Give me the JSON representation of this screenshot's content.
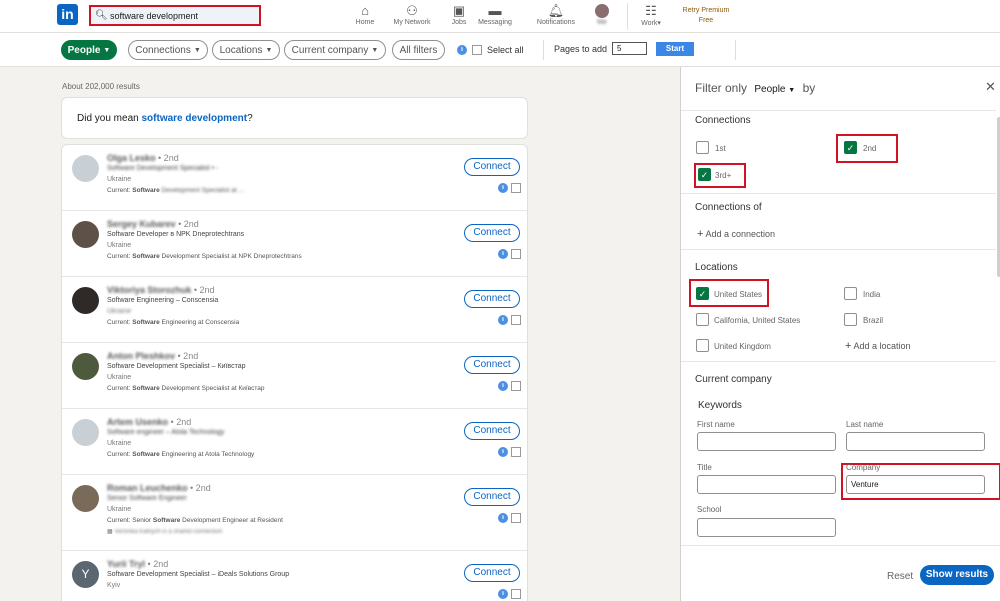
{
  "nav": {
    "logo": "in",
    "search_value": "software development",
    "items": [
      {
        "label": "Home",
        "icon": "home-icon"
      },
      {
        "label": "My Network",
        "icon": "network-icon"
      },
      {
        "label": "Jobs",
        "icon": "briefcase-icon"
      },
      {
        "label": "Messaging",
        "icon": "messaging-icon"
      },
      {
        "label": "Notifications",
        "icon": "bell-icon"
      },
      {
        "label": "Me",
        "icon": "avatar"
      },
      {
        "label": "Work",
        "icon": "grid-icon"
      }
    ],
    "premium_line1": "Retry Premium",
    "premium_line2": "Free"
  },
  "filters": {
    "people": "People",
    "connections": "Connections",
    "locations": "Locations",
    "current_company": "Current company",
    "all_filters": "All filters",
    "select_all": "Select all",
    "pages_to_add_label": "Pages to add",
    "pages_to_add_value": "5",
    "start": "Start"
  },
  "results": {
    "count": "About 202,000 results",
    "did_you_mean_prefix": "Did you mean ",
    "did_you_mean_link": "software development",
    "did_you_mean_suffix": "?",
    "connect_label": "Connect",
    "people": [
      {
        "name": "Olga Lesko",
        "degree": "• 2nd",
        "headline": "Software Development Specialist • -",
        "location": "Ukraine",
        "current_prefix": "Current: ",
        "current_bold": "Software",
        "current_rest": " Development Specialist at ...",
        "extra": ""
      },
      {
        "name": "Sergey Kubarev",
        "degree": "• 2nd",
        "headline": "Software Developer в NPK Dneprotechtrans",
        "location": "Ukraine",
        "current_prefix": "Current: ",
        "current_bold": "Software",
        "current_rest": " Development Specialist at NPK Dneprotechtrans",
        "extra": ""
      },
      {
        "name": "Viktoriya Storozhuk",
        "degree": "• 2nd",
        "headline": "Software Engineering – Conscensia",
        "location": "Ukraine",
        "current_prefix": "Current: ",
        "current_bold": "Software",
        "current_rest": " Engineering at Conscensia",
        "extra": ""
      },
      {
        "name": "Anton Pleshkov",
        "degree": "• 2nd",
        "headline": "Software Development Specialist – Київстар",
        "location": "Ukraine",
        "current_prefix": "Current: ",
        "current_bold": "Software",
        "current_rest": " Development Specialist at Київстар",
        "extra": ""
      },
      {
        "name": "Artem Usenko",
        "degree": "• 2nd",
        "headline": "Software engineer – Atola Technology",
        "location": "Ukraine",
        "current_prefix": "Current: ",
        "current_bold": "Software",
        "current_rest": " Engineering at Atola Technology",
        "extra": ""
      },
      {
        "name": "Roman Leuchenko",
        "degree": "• 2nd",
        "headline": "Senior Software Engineer",
        "location": "Ukraine",
        "current_prefix": "Current: Senior ",
        "current_bold": "Software",
        "current_rest": " Development Engineer at Resident",
        "extra": "Veronika Kalnych is a shared connection"
      },
      {
        "name": "Yurii Tryl",
        "degree": "• 2nd",
        "headline": "Software Development Specialist – iDeals Solutions Group",
        "location": "Kyiv",
        "current_prefix": "",
        "current_bold": "",
        "current_rest": "",
        "extra": ""
      }
    ]
  },
  "panel": {
    "filter_only": "Filter only",
    "filter_type": "People",
    "by": "by",
    "connections_title": "Connections",
    "conn_1st": "1st",
    "conn_2nd": "2nd",
    "conn_3rd": "3rd+",
    "connections_of_title": "Connections of",
    "add_connection": "Add a connection",
    "locations_title": "Locations",
    "loc_us": "United States",
    "loc_india": "India",
    "loc_california": "California, United States",
    "loc_brazil": "Brazil",
    "loc_uk": "United Kingdom",
    "add_location": "Add a location",
    "current_company_title": "Current company",
    "keywords_title": "Keywords",
    "first_name": "First name",
    "last_name": "Last name",
    "title": "Title",
    "company": "Company",
    "company_value": "Venture",
    "school": "School",
    "reset": "Reset",
    "show_results": "Show results"
  },
  "colors": {
    "brand": "#0a66c2",
    "active_green": "#057642",
    "highlight_red": "#d11124"
  }
}
